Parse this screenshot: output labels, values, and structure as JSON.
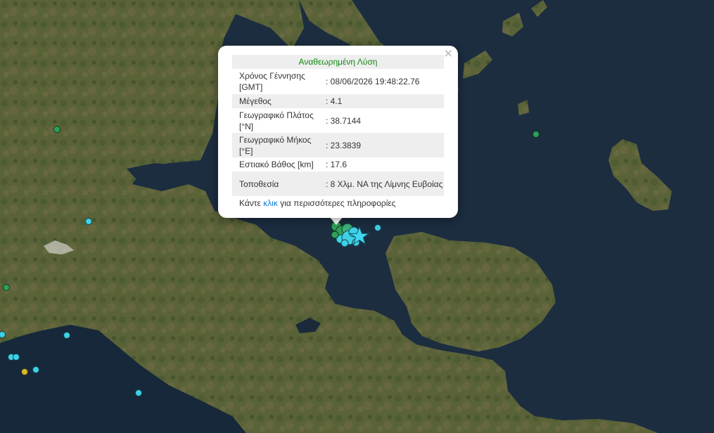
{
  "popup": {
    "title": "Αναθεωρημένη Λύση",
    "close_symbol": "×",
    "rows": [
      {
        "label": "Χρόνος Γέννησης [GMT]",
        "value": ": 08/06/2026 19:48:22.76"
      },
      {
        "label": "Μέγεθος",
        "value": ": 4.1"
      },
      {
        "label": "Γεωγραφικό Πλάτος [°N]",
        "value": ": 38.7144"
      },
      {
        "label": "Γεωγραφικό Μήκος [°E]",
        "value": ": 23.3839"
      },
      {
        "label": "Εστιακό Βάθος [km]",
        "value": ": 17.6"
      },
      {
        "label": "Τοποθεσία",
        "value": ": 8 Χλμ. ΝΑ της Λίμνης Ευβοίας"
      }
    ],
    "more_prefix": "Κάντε ",
    "more_link": "κλικ",
    "more_suffix": " για περισσότερες πληροφορίες"
  },
  "colors": {
    "sea": "#1c2d40",
    "land": "#57603a",
    "highlight_star": "#40d8f0",
    "marker_green": "#2fa05a",
    "marker_cyan": "#3fd0e4",
    "marker_yellow": "#d8b830",
    "popup_title": "#118811",
    "link": "#0a7ad8"
  }
}
